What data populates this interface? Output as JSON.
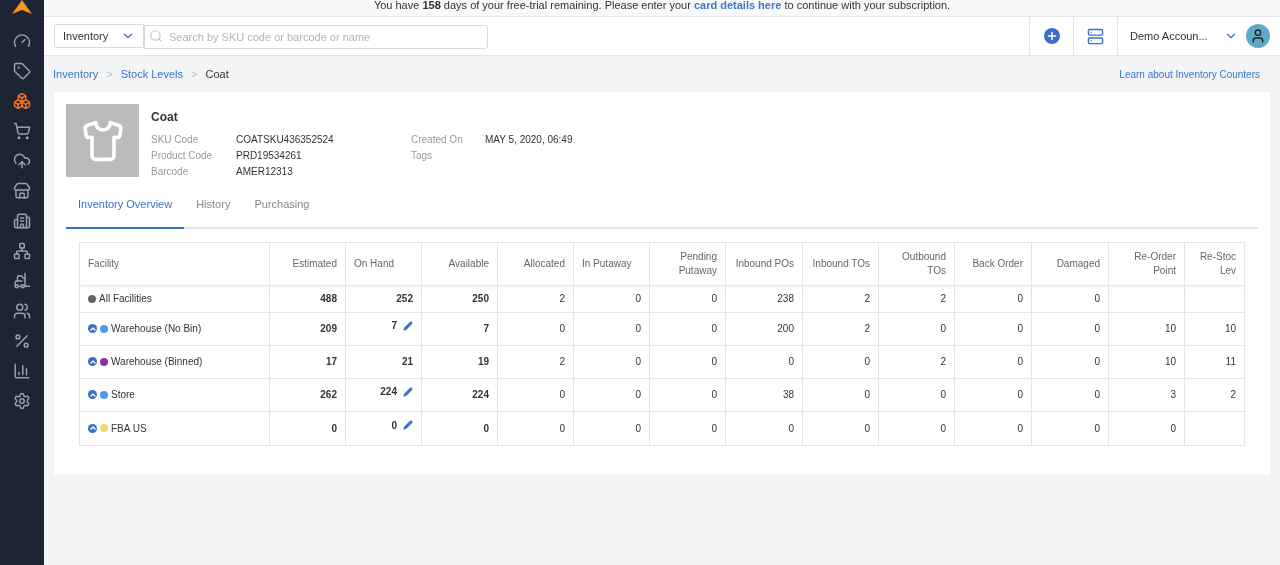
{
  "banner": {
    "before": "You have",
    "days": "158",
    "middle": "days of your free-trial remaining. Please enter your",
    "link": "card details here",
    "after": "to continue with your subscription."
  },
  "sidebar": {
    "items": [
      {
        "kind": "gauge",
        "selected": false
      },
      {
        "kind": "tag",
        "selected": false
      },
      {
        "kind": "boxes",
        "selected": true
      },
      {
        "kind": "cart",
        "selected": false
      },
      {
        "kind": "upload",
        "selected": false
      },
      {
        "kind": "store",
        "selected": false
      },
      {
        "kind": "building",
        "selected": false
      },
      {
        "kind": "network",
        "selected": false
      },
      {
        "kind": "forklift",
        "selected": false
      },
      {
        "kind": "users",
        "selected": false
      },
      {
        "kind": "percent",
        "selected": false
      },
      {
        "kind": "chart",
        "selected": false
      },
      {
        "kind": "settings",
        "selected": false
      }
    ]
  },
  "header": {
    "scope": "Inventory",
    "search": {
      "placeholder": "Search by SKU code or barcode or name"
    },
    "account": "Demo Accoun..."
  },
  "breadcrumbs": {
    "separator": ">",
    "items": [
      {
        "label": "Inventory",
        "link": true
      },
      {
        "label": "Stock Levels",
        "link": true
      },
      {
        "label": "Coat",
        "link": false
      }
    ]
  },
  "help_link": "Learn about Inventory Counters",
  "product": {
    "name": "Coat",
    "fields": [
      {
        "label": "SKU Code",
        "value": "COATSKU436352524"
      },
      {
        "label": "Product Code",
        "value": "PRD19534261"
      },
      {
        "label": "Barcode",
        "value": "AMER12313"
      }
    ],
    "meta": [
      {
        "label": "Created On",
        "value": "MAY 5, 2020, 06:49"
      },
      {
        "label": "Tags"
      }
    ]
  },
  "tabs": [
    {
      "label": "Inventory Overview",
      "selected": true
    },
    {
      "label": "History",
      "selected": false
    },
    {
      "label": "Purchasing",
      "selected": false
    }
  ],
  "table": {
    "columns": [
      "Facility",
      "Estimated",
      "On Hand",
      "Available",
      "Allocated",
      "In Putaway",
      "Pending Putaway",
      "Inbound POs",
      "Inbound TOs",
      "Outbound TOs",
      "Back Order",
      "Damaged",
      "Re-Order Point",
      "Re-Stoc Lev"
    ],
    "rows": [
      {
        "color": "#5f6670",
        "expandable": false,
        "editable": false,
        "cells": [
          "All Facilities",
          "488",
          "252",
          "250",
          "2",
          "0",
          "0",
          "238",
          "2",
          "2",
          "0",
          "0",
          "",
          ""
        ]
      },
      {
        "color": "#4a9be6",
        "expandable": true,
        "editable": true,
        "cells": [
          "Warehouse (No Bin)",
          "209",
          "7",
          "7",
          "0",
          "0",
          "0",
          "200",
          "2",
          "0",
          "0",
          "0",
          "10",
          "10"
        ]
      },
      {
        "color": "#8e2ea8",
        "expandable": true,
        "editable": false,
        "cells": [
          "Warehouse (Binned)",
          "17",
          "21",
          "19",
          "2",
          "0",
          "0",
          "0",
          "0",
          "2",
          "0",
          "0",
          "10",
          "11"
        ]
      },
      {
        "color": "#4a9be6",
        "expandable": true,
        "editable": true,
        "cells": [
          "Store",
          "262",
          "224",
          "224",
          "0",
          "0",
          "0",
          "38",
          "0",
          "0",
          "0",
          "0",
          "3",
          "2"
        ]
      },
      {
        "color": "#f5d76e",
        "expandable": true,
        "editable": true,
        "cells": [
          "FBA US",
          "0",
          "0",
          "0",
          "0",
          "0",
          "0",
          "0",
          "0",
          "0",
          "0",
          "0",
          "0",
          ""
        ]
      }
    ]
  }
}
